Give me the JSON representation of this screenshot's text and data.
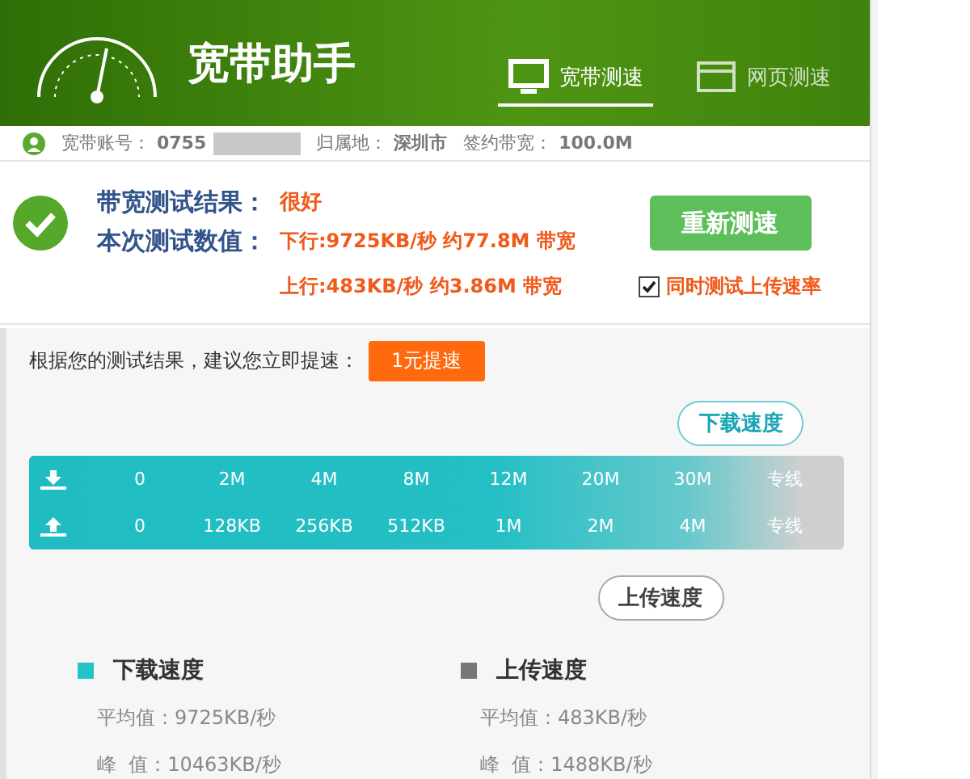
{
  "header": {
    "title": "宽带助手",
    "tabs": [
      {
        "label": "宽带测速",
        "selected": true
      },
      {
        "label": "网页测速",
        "selected": false
      }
    ]
  },
  "account": {
    "account_label": "宽带账号：",
    "account_value": "0755",
    "region_label": "归属地：",
    "region_value": "深圳市",
    "plan_label": "签约带宽：",
    "plan_value": "100.0M"
  },
  "result": {
    "rating_label": "带宽测试结果：",
    "rating": "很好",
    "values_label": "本次测试数值：",
    "download": "下行:9725KB/秒 约77.8M 带宽",
    "upload": "上行:483KB/秒 约3.86M 带宽",
    "retest_button": "重新测速",
    "upload_test": {
      "label": "同时测试上传速率",
      "checked": true
    }
  },
  "suggestion": {
    "text": "根据您的测试结果，建议您立即提速：",
    "button": "1元提速"
  },
  "gauge": {
    "download": {
      "bubble": "下载速度",
      "level": 0.95
    },
    "upload": {
      "bubble": "上传速度",
      "level": 0.81
    },
    "download_ticks": [
      "0",
      "2M",
      "4M",
      "8M",
      "12M",
      "20M",
      "30M",
      "专线"
    ],
    "upload_ticks": [
      "0",
      "128KB",
      "256KB",
      "512KB",
      "1M",
      "2M",
      "4M",
      "专线"
    ]
  },
  "stats": [
    {
      "title": "下载速度",
      "color": "#22c4c8",
      "average": "平均值：9725KB/秒",
      "peak": "峰  值：10463KB/秒"
    },
    {
      "title": "上传速度",
      "color": "#777777",
      "average": "平均值：483KB/秒",
      "peak": "峰  值：1488KB/秒"
    }
  ]
}
